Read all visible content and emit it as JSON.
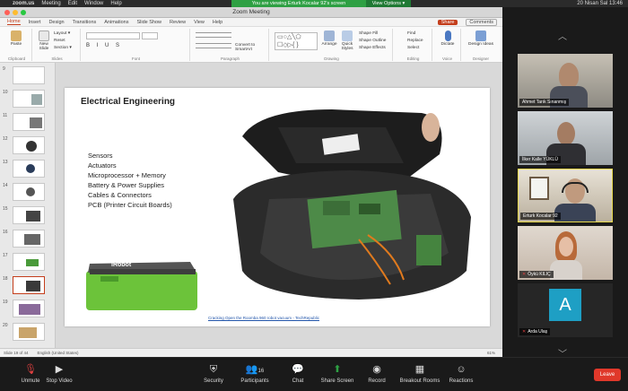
{
  "menubar": {
    "app": "zoom.us",
    "items": [
      "Meeting",
      "Edit",
      "Window",
      "Help"
    ],
    "clock": "20 Nisan Sal 13:46"
  },
  "share_banner": {
    "text": "You are viewing Erturk Kocalar 92's screen",
    "view_options": "View Options ▾"
  },
  "window": {
    "title": "Zoom Meeting"
  },
  "ribbon": {
    "tabs": [
      "Home",
      "Insert",
      "Design",
      "Transitions",
      "Animations",
      "Slide Show",
      "Review",
      "View",
      "Help"
    ],
    "active_tab": "Home",
    "share": "Share",
    "comments": "Comments",
    "groups": {
      "clipboard": "Clipboard",
      "slides": "Slides",
      "font": "Font",
      "paragraph": "Paragraph",
      "drawing": "Drawing",
      "editing": "Editing",
      "voice": "Voice",
      "designer": "Designer"
    },
    "buttons": {
      "paste": "Paste",
      "new_slide": "New Slide",
      "layout": "Layout ▾",
      "reset": "Reset",
      "section": "Section ▾",
      "convert_smartart": "Convert to SmartArt",
      "arrange": "Arrange",
      "quick_styles": "Quick Styles",
      "shape_fill": "Shape Fill",
      "shape_outline": "Shape Outline",
      "shape_effects": "Shape Effects",
      "find": "Find",
      "replace": "Replace",
      "select": "Select",
      "dictate": "Dictate",
      "design_ideas": "Design Ideas"
    }
  },
  "thumbnails": [
    "9",
    "10",
    "11",
    "12",
    "13",
    "14",
    "15",
    "16",
    "17",
    "18",
    "19",
    "20"
  ],
  "slide": {
    "title": "Electrical Engineering",
    "bullets": [
      "Sensors",
      "Actuators",
      "Microprocessor + Memory",
      "Battery & Power Supplies",
      "Cables & Connectors",
      "PCB (Printer Circuit Boards)"
    ],
    "battery_label": "iRobot",
    "link": "Cracking Open the Roomba 960 robot vacuum - TechRepublic"
  },
  "statusbar": {
    "slide_info": "Slide 19 of 44",
    "language": "English (United States)",
    "zoom": "61%"
  },
  "participants": [
    {
      "name": "Ahmet Tarık Sınanmış",
      "muted": false
    },
    {
      "name": "İlker Kalle YÜKLÜ",
      "muted": false
    },
    {
      "name": "Erturk Kocalar 92",
      "muted": false,
      "active": true
    },
    {
      "name": "Öykü KILIÇ",
      "muted": true
    },
    {
      "name": "Arda Ulaş",
      "muted": true,
      "initial": "A"
    }
  ],
  "controls": {
    "unmute": "Unmute",
    "stop_video": "Stop Video",
    "security": "Security",
    "participants": "Participants",
    "participants_count": "16",
    "chat": "Chat",
    "share_screen": "Share Screen",
    "record": "Record",
    "breakout_rooms": "Breakout Rooms",
    "reactions": "Reactions",
    "leave": "Leave"
  },
  "colors": {
    "share_green": "#2ea043",
    "ppt_accent": "#c43e1c",
    "active_speaker": "#e6d84b",
    "leave_red": "#e0382a",
    "avatar_teal": "#1e9fc4"
  }
}
